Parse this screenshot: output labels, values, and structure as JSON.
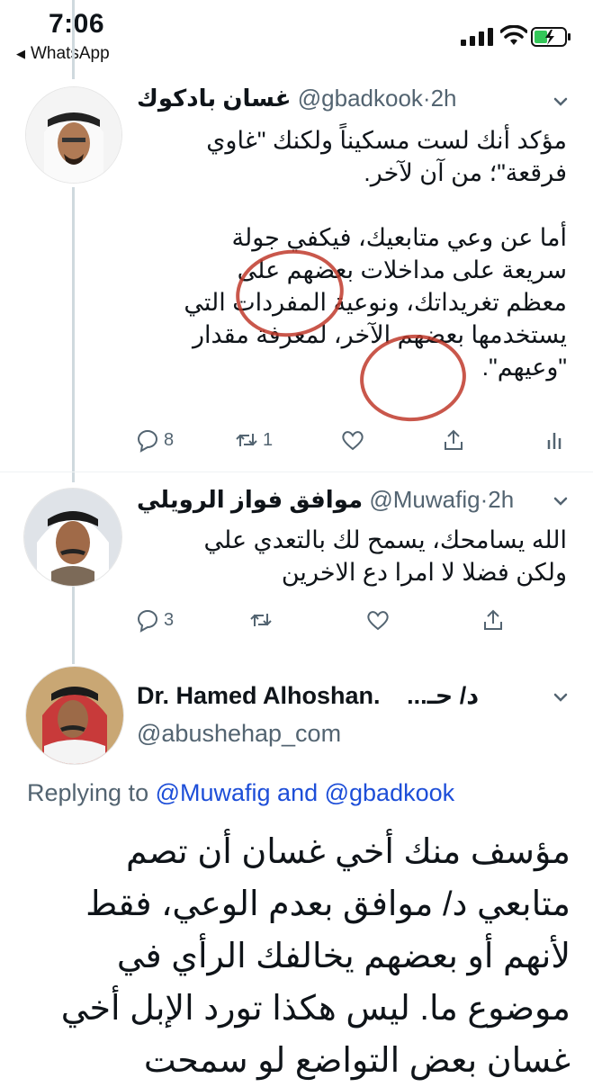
{
  "status_bar": {
    "time": "7:06",
    "back_label": "WhatsApp"
  },
  "tweets": [
    {
      "name": "غسان بادكوك",
      "handle": "@gbadkook",
      "time": "·2h",
      "text": "مؤكد أنك لست مسكيناً ولكنك \"غاوي\nفرقعة\"؛ من آن لآخر.\n\nأما عن وعي متابعيك، فيكفي جولة\nسريعة على مداخلات بعضهم على\nمعظم تغريداتك، ونوعية المفردات التي\nيستخدمها بعضهم الآخر، لمعرفة مقدار\n\"وعيهم\".",
      "replies": "8",
      "retweets": "1"
    },
    {
      "name": "موافق فواز الرويلي",
      "handle": "@Muwafig",
      "time": "·2h",
      "text": "الله يسامحك، يسمح لك بالتعدي علي\nولكن فضلا لا امرا دع الاخرين",
      "replies": "3"
    },
    {
      "name": "Dr. Hamed Alhoshan.",
      "name_suffix": "د/ حـ...",
      "handle": "@abushehap_com",
      "replying_prefix": "Replying to",
      "replying_users": "@Muwafig and @gbadkook",
      "text": "مؤسف منك أخي غسان أن تصم\nمتابعي د/ موافق بعدم الوعي، فقط\nلأنهم أو بعضهم يخالفك الرأي في\nموضوع ما. ليس هكذا تورد الإبل أخي\nغسان بعض التواضع لو سمحت"
    }
  ],
  "icons": {
    "reply": "reply-icon",
    "retweet": "retweet-icon",
    "like": "heart-icon",
    "share": "share-icon",
    "analytics": "analytics-icon",
    "more": "chevron-down-icon"
  },
  "colors": {
    "accent_link": "#1d4ed8",
    "muted": "#536471",
    "annotation": "#c0392b",
    "battery": "#34c759"
  }
}
